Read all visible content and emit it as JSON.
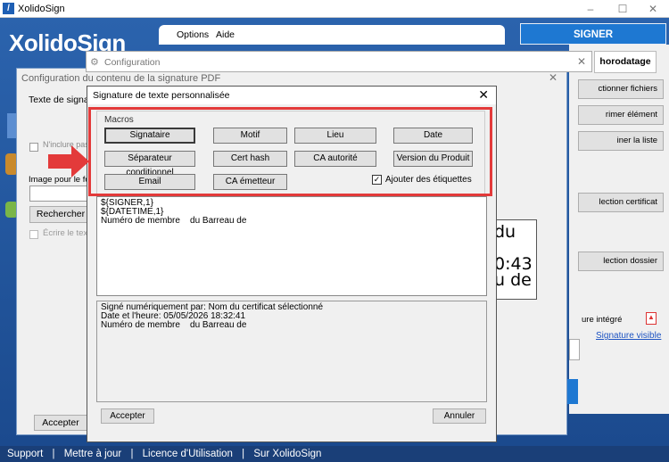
{
  "app": {
    "title": "XolidoSign",
    "brand": "XolidoSign"
  },
  "menu": {
    "options": "Options",
    "help": "Aide"
  },
  "signer_tab": "SIGNER",
  "right": {
    "horodatage": "horodatage",
    "buttons": [
      "ctionner fichiers",
      "rimer élément",
      "iner la liste",
      "lection certificat",
      "lection dossier"
    ],
    "pdf_label": "ure intégré",
    "visible_link": "Signature visible"
  },
  "config_outer": {
    "title": "Configuration du contenu de la signature PDF",
    "text_label": "Texte de signature",
    "checkbox1": "N'inclure pas la",
    "image_label": "Image pour le fond",
    "browse": "Rechercher",
    "checkbox2": "Écrire le texte",
    "accept": "Accepter"
  },
  "config_inner": {
    "title": "Configuration"
  },
  "dialog": {
    "title": "Signature de texte personnalisée",
    "macros_legend": "Macros",
    "macros": [
      "Signataire",
      "Motif",
      "Lieu",
      "Date",
      "Séparateur conditionnel",
      "Cert hash",
      "CA autorité",
      "Version du Produit",
      "Email",
      "CA émetteur"
    ],
    "add_labels": "Ajouter des étiquettes",
    "add_labels_checked": true,
    "editor_lines": [
      "${SIGNER,1}",
      "${DATETIME,1}",
      "Numéro de membre    du Barreau de"
    ],
    "preview_lines": [
      "Signé numériquement par: Nom du certificat sélectionné",
      "Date et l'heure: 05/05/2026 18:32:41",
      "Numéro de membre    du Barreau de"
    ],
    "accept": "Accepter",
    "cancel": "Annuler"
  },
  "preview_box": {
    "lines": [
      "du",
      "0:43",
      "u de"
    ]
  },
  "footer": {
    "items": [
      "Support",
      "Mettre à jour",
      "Licence d'Utilisation",
      "Sur XolidoSign"
    ]
  },
  "colors": {
    "highlight": "#e33a3a",
    "accent": "#1e78d2"
  }
}
